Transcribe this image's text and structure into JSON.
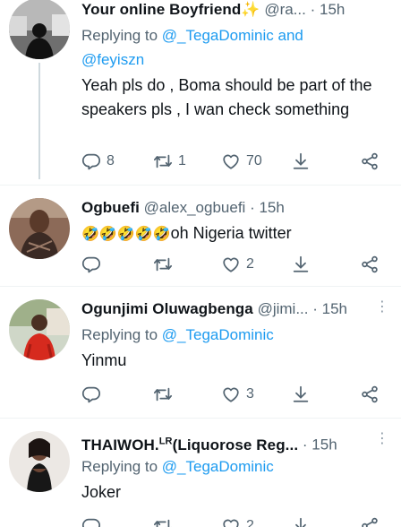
{
  "tweets": [
    {
      "name": "Your online Boyfriend",
      "name_emoji": "✨",
      "handle": "@ra...",
      "time": "15h",
      "replying_prefix": "Replying to",
      "replying_to": "@_TegaDominic and",
      "replying_to_2": "@feyiszn",
      "text": "Yeah pls do , Boma should be part of the speakers pls , I wan check something",
      "replies": "8",
      "retweets": "1",
      "likes": "70"
    },
    {
      "name": "Ogbuefi",
      "handle": "@alex_ogbuefi",
      "time": "15h",
      "text_emojis": "🤣🤣🤣🤣🤣",
      "text": "oh Nigeria twitter",
      "replies": "",
      "retweets": "",
      "likes": "2"
    },
    {
      "name": "Ogunjimi Oluwagbenga",
      "handle": "@jimi...",
      "time": "15h",
      "replying_prefix": "Replying to",
      "replying_to": "@_TegaDominic",
      "text": "Yinmu",
      "replies": "",
      "retweets": "",
      "likes": "3"
    },
    {
      "name": "THAIWOH.",
      "name_sup": "LR",
      "name_rest": "(Liquorose Reg...",
      "time": "15h",
      "replying_prefix": "Replying to",
      "replying_to": "@_TegaDominic",
      "text": "Joker",
      "replies": "",
      "retweets": "",
      "likes": "2"
    }
  ],
  "colors": {
    "link": "#1d9bf0",
    "secondary": "#536471",
    "divider": "#eff3f4"
  },
  "icons": [
    "reply-icon",
    "retweet-icon",
    "like-icon",
    "download-icon",
    "share-icon",
    "more-icon"
  ]
}
